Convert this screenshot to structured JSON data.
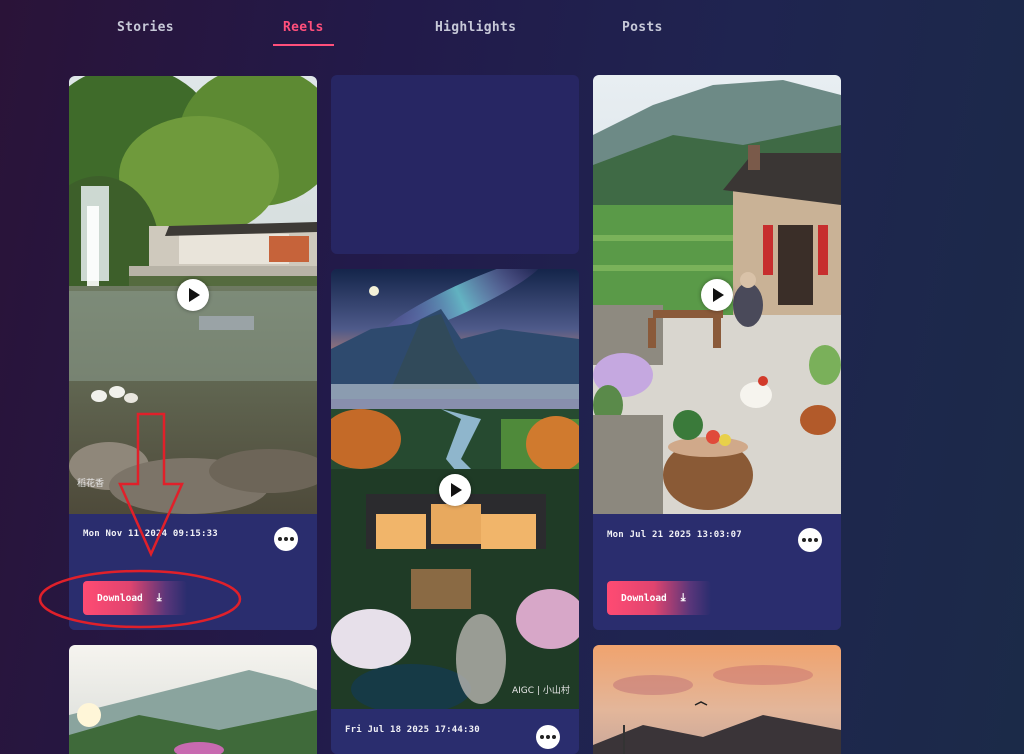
{
  "tabs": [
    {
      "label": "Stories"
    },
    {
      "label": "Reels",
      "active": true
    },
    {
      "label": "Highlights"
    },
    {
      "label": "Posts"
    }
  ],
  "cards": {
    "waterfall": {
      "date": "Mon Nov 11 2024 09:15:33",
      "download_label": "Download",
      "watermark": "稻花香"
    },
    "valley": {
      "date": "Fri Jul 18 2025 17:44:30",
      "watermark": "AIGC | 小山村"
    },
    "courtyard": {
      "date": "Mon Jul 21 2025 13:03:07",
      "download_label": "Download"
    }
  },
  "icons": {
    "play": "play-icon",
    "more": "more-icon",
    "download": "download-icon"
  },
  "colors": {
    "accent": "#ff4f7b",
    "card_bg": "#2a2d6e",
    "annotation": "#e0202a"
  }
}
